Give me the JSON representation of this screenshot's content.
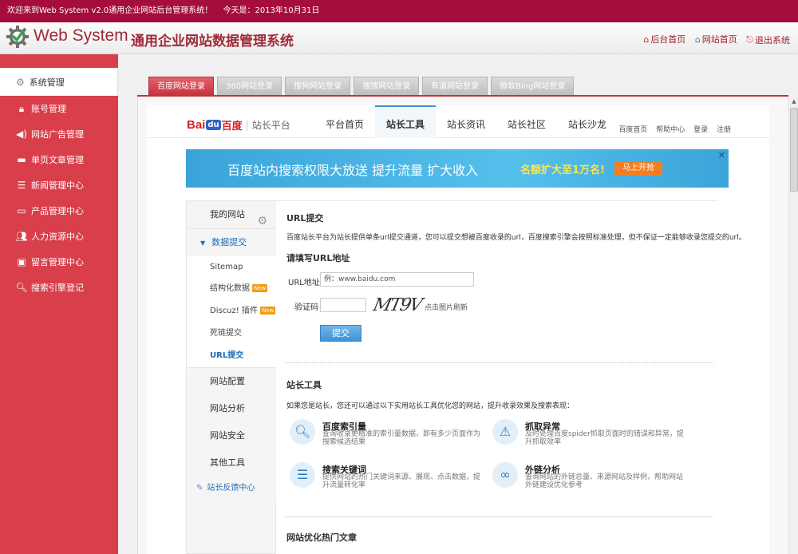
{
  "topbar": {
    "welcome": "欢迎来到Web System v2.0通用企业网站后台管理系统！",
    "today": "今天是：2013年10月31日"
  },
  "header": {
    "title_en": "Web System",
    "title_cn": "通用企业网站数据管理系统",
    "links": [
      {
        "label": "后台首页",
        "icon": "house-icon"
      },
      {
        "label": "网站首页",
        "icon": "house-icon"
      },
      {
        "label": "退出系统",
        "icon": "logout-icon"
      }
    ]
  },
  "sidebar": {
    "system": "系统管理",
    "items": [
      {
        "label": "账号管理",
        "icon": "lock-icon"
      },
      {
        "label": "网站广告管理",
        "icon": "speaker-icon"
      },
      {
        "label": "单页文章管理",
        "icon": "document-icon"
      },
      {
        "label": "新闻管理中心",
        "icon": "list-icon"
      },
      {
        "label": "产品管理中心",
        "icon": "monitor-icon"
      },
      {
        "label": "人力资源中心",
        "icon": "users-icon"
      },
      {
        "label": "留言管理中心",
        "icon": "message-icon"
      },
      {
        "label": "搜索引擎登记",
        "icon": "search-icon"
      }
    ]
  },
  "tabs": [
    "百度网站登录",
    "360网站登录",
    "搜狗网站登录",
    "搜搜网站登录",
    "有道网站登录",
    "微软Bing网站登录"
  ],
  "baidu": {
    "logo_bai": "Bai",
    "logo_du": "du",
    "logo_cn": "百度",
    "logo_sep": "|",
    "platform": "站长平台",
    "nav": [
      "平台首页",
      "站长工具",
      "站长资讯",
      "站长社区",
      "站长沙龙"
    ],
    "mini": [
      "百度首页",
      "帮助中心",
      "登录",
      "注册"
    ],
    "banner": {
      "text": "百度站内搜索权限大放送 提升流量 扩大收入",
      "highlight": "名额扩大至1万名!",
      "button": "马上开抢",
      "close": "✕"
    }
  },
  "leftnav": {
    "my_site": "我的网站",
    "data_submit": "数据提交",
    "subs": [
      {
        "label": "Sitemap"
      },
      {
        "label": "结构化数据",
        "badge": "New"
      },
      {
        "label": "Discuz! 插件",
        "badge": "New"
      },
      {
        "label": "死链提交"
      },
      {
        "label": "URL提交"
      }
    ],
    "groups": [
      "网站配置",
      "网站分析",
      "网站安全",
      "其他工具"
    ],
    "feedback": "站长反馈中心"
  },
  "content": {
    "url_title": "URL提交",
    "url_desc": "百度站长平台为站长提供单条url提交通道，您可以提交想被百度收录的url，百度搜索引擎会按照标准处理，但不保证一定能够收录您提交的url。",
    "form_title": "请填写URL地址",
    "url_label": "URL地址",
    "url_placeholder": "例：www.baidu.com",
    "code_label": "验证码",
    "captcha_text": "MT9V",
    "refresh": "点击图片刷新",
    "submit": "提交",
    "tools_title": "站长工具",
    "tools_desc": "如果您是站长，您还可以通过以下实用站长工具优化您的网站，提升收录效果及搜索表现：",
    "tools": [
      {
        "name": "百度索引量",
        "desc": "查询收录更精准的索引量数据，即有多少页面作为搜索候选结果",
        "icon": "search-icon"
      },
      {
        "name": "抓取异常",
        "desc": "及时处理百度spider抓取页面时的错误和异常，提升抓取效率",
        "icon": "warning-icon"
      },
      {
        "name": "搜索关键词",
        "desc": "提供网站的热门关键词来源、展现、点击数据，提升流量转化率",
        "icon": "list-icon"
      },
      {
        "name": "外链分析",
        "desc": "查询网站的外链总量、来源网站及样例，帮助网站外链建设优化参考",
        "icon": "link-icon"
      }
    ],
    "hot_title": "网站优化热门文章"
  },
  "colors": {
    "topbar": "#a50d3c",
    "sidebar": "#d83f4b",
    "accent_blue": "#3b8fd6"
  }
}
